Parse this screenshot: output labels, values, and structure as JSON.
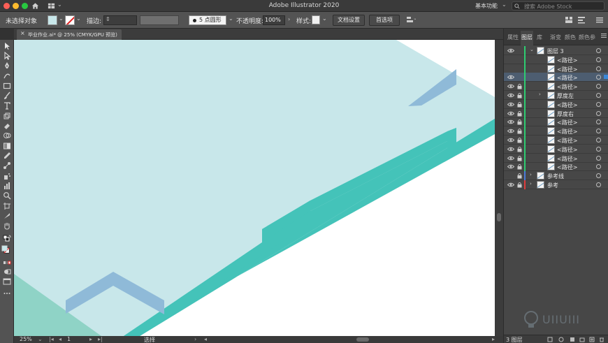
{
  "app": {
    "title": "Adobe Illustrator 2020",
    "workspace": "基本功能",
    "search_placeholder": "搜索 Adobe Stock"
  },
  "control_bar": {
    "selection_status": "未选择对象",
    "stroke_label": "描边:",
    "brush_label": "5 点圆形",
    "opacity_label": "不透明度:",
    "opacity_value": "100%",
    "style_label": "样式:",
    "doc_setup_button": "文档设置",
    "preferences_button": "首选项"
  },
  "document": {
    "tab_label": "毕业作业.ai* @ 25% (CMYK/GPU 预览)",
    "close_glyph": "×"
  },
  "status_bar": {
    "zoom": "25%",
    "artboard": "1",
    "tool": "选择"
  },
  "panel": {
    "tabs": [
      "属性",
      "图层",
      "库",
      "渐变",
      "颜色",
      "颜色参"
    ],
    "active_tab": "图层",
    "footer_label": "3 图层"
  },
  "layers": [
    {
      "name": "图层 3",
      "level": 0,
      "expanded": true,
      "color": "#2ecc71",
      "visible": true,
      "locked": false,
      "selected": false
    },
    {
      "name": "<路径>",
      "level": 1,
      "color": "#2ecc71",
      "visible": false,
      "locked": false,
      "selected": false
    },
    {
      "name": "<路径>",
      "level": 1,
      "color": "#2ecc71",
      "visible": false,
      "locked": false,
      "selected": false
    },
    {
      "name": "<路径>",
      "level": 1,
      "color": "#2ecc71",
      "visible": true,
      "locked": false,
      "selected": true
    },
    {
      "name": "<路径>",
      "level": 1,
      "color": "#2ecc71",
      "visible": true,
      "locked": true,
      "selected": false
    },
    {
      "name": "厚度左",
      "level": 1,
      "group": true,
      "color": "#2ecc71",
      "visible": true,
      "locked": true,
      "selected": false
    },
    {
      "name": "<路径>",
      "level": 1,
      "color": "#2ecc71",
      "visible": true,
      "locked": true,
      "selected": false
    },
    {
      "name": "厚度右",
      "level": 1,
      "color": "#2ecc71",
      "visible": true,
      "locked": true,
      "selected": false
    },
    {
      "name": "<路径>",
      "level": 1,
      "color": "#2ecc71",
      "visible": true,
      "locked": true,
      "selected": false
    },
    {
      "name": "<路径>",
      "level": 1,
      "color": "#2ecc71",
      "visible": true,
      "locked": true,
      "selected": false
    },
    {
      "name": "<路径>",
      "level": 1,
      "color": "#2ecc71",
      "visible": true,
      "locked": true,
      "selected": false
    },
    {
      "name": "<路径>",
      "level": 1,
      "color": "#2ecc71",
      "visible": true,
      "locked": true,
      "selected": false
    },
    {
      "name": "<路径>",
      "level": 1,
      "color": "#2ecc71",
      "visible": true,
      "locked": true,
      "selected": false
    },
    {
      "name": "<路径>",
      "level": 1,
      "color": "#2ecc71",
      "visible": true,
      "locked": true,
      "selected": false
    },
    {
      "name": "参考线",
      "level": 0,
      "expanded": false,
      "color": "#4a7bd8",
      "visible": false,
      "locked": true,
      "selected": false
    },
    {
      "name": "参考",
      "level": 0,
      "expanded": false,
      "color": "#e03c3c",
      "visible": true,
      "locked": true,
      "selected": false
    }
  ],
  "artwork_colors": {
    "top_face": "#c8e7ea",
    "side_face": "#44c3b9",
    "accent_blue": "#8fbad8",
    "left_face": "#8fd3c6"
  },
  "watermark": {
    "text": "UIIUIII"
  }
}
